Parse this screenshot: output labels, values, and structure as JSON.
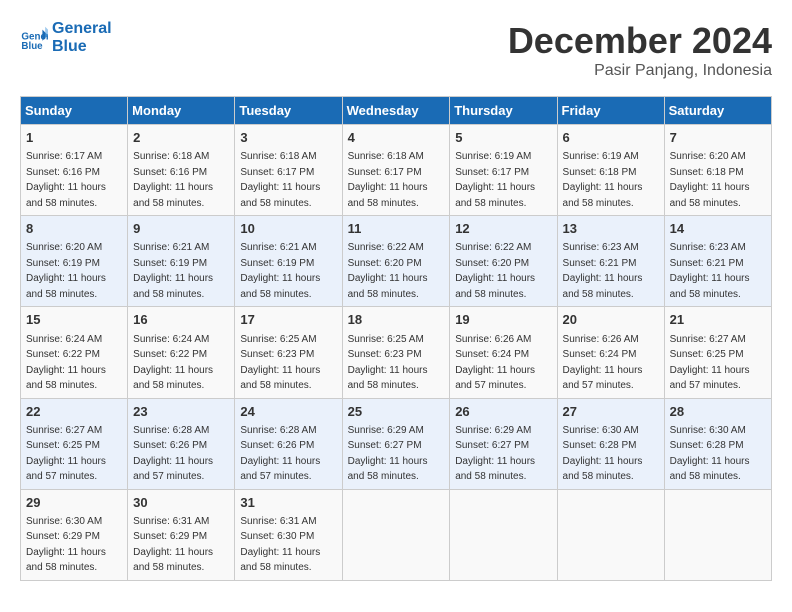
{
  "header": {
    "logo_line1": "General",
    "logo_line2": "Blue",
    "month": "December 2024",
    "location": "Pasir Panjang, Indonesia"
  },
  "days_of_week": [
    "Sunday",
    "Monday",
    "Tuesday",
    "Wednesday",
    "Thursday",
    "Friday",
    "Saturday"
  ],
  "weeks": [
    [
      {
        "day": "1",
        "sunrise": "6:17 AM",
        "sunset": "6:16 PM",
        "daylight": "11 hours and 58 minutes."
      },
      {
        "day": "2",
        "sunrise": "6:18 AM",
        "sunset": "6:16 PM",
        "daylight": "11 hours and 58 minutes."
      },
      {
        "day": "3",
        "sunrise": "6:18 AM",
        "sunset": "6:17 PM",
        "daylight": "11 hours and 58 minutes."
      },
      {
        "day": "4",
        "sunrise": "6:18 AM",
        "sunset": "6:17 PM",
        "daylight": "11 hours and 58 minutes."
      },
      {
        "day": "5",
        "sunrise": "6:19 AM",
        "sunset": "6:17 PM",
        "daylight": "11 hours and 58 minutes."
      },
      {
        "day": "6",
        "sunrise": "6:19 AM",
        "sunset": "6:18 PM",
        "daylight": "11 hours and 58 minutes."
      },
      {
        "day": "7",
        "sunrise": "6:20 AM",
        "sunset": "6:18 PM",
        "daylight": "11 hours and 58 minutes."
      }
    ],
    [
      {
        "day": "8",
        "sunrise": "6:20 AM",
        "sunset": "6:19 PM",
        "daylight": "11 hours and 58 minutes."
      },
      {
        "day": "9",
        "sunrise": "6:21 AM",
        "sunset": "6:19 PM",
        "daylight": "11 hours and 58 minutes."
      },
      {
        "day": "10",
        "sunrise": "6:21 AM",
        "sunset": "6:19 PM",
        "daylight": "11 hours and 58 minutes."
      },
      {
        "day": "11",
        "sunrise": "6:22 AM",
        "sunset": "6:20 PM",
        "daylight": "11 hours and 58 minutes."
      },
      {
        "day": "12",
        "sunrise": "6:22 AM",
        "sunset": "6:20 PM",
        "daylight": "11 hours and 58 minutes."
      },
      {
        "day": "13",
        "sunrise": "6:23 AM",
        "sunset": "6:21 PM",
        "daylight": "11 hours and 58 minutes."
      },
      {
        "day": "14",
        "sunrise": "6:23 AM",
        "sunset": "6:21 PM",
        "daylight": "11 hours and 58 minutes."
      }
    ],
    [
      {
        "day": "15",
        "sunrise": "6:24 AM",
        "sunset": "6:22 PM",
        "daylight": "11 hours and 58 minutes."
      },
      {
        "day": "16",
        "sunrise": "6:24 AM",
        "sunset": "6:22 PM",
        "daylight": "11 hours and 58 minutes."
      },
      {
        "day": "17",
        "sunrise": "6:25 AM",
        "sunset": "6:23 PM",
        "daylight": "11 hours and 58 minutes."
      },
      {
        "day": "18",
        "sunrise": "6:25 AM",
        "sunset": "6:23 PM",
        "daylight": "11 hours and 58 minutes."
      },
      {
        "day": "19",
        "sunrise": "6:26 AM",
        "sunset": "6:24 PM",
        "daylight": "11 hours and 57 minutes."
      },
      {
        "day": "20",
        "sunrise": "6:26 AM",
        "sunset": "6:24 PM",
        "daylight": "11 hours and 57 minutes."
      },
      {
        "day": "21",
        "sunrise": "6:27 AM",
        "sunset": "6:25 PM",
        "daylight": "11 hours and 57 minutes."
      }
    ],
    [
      {
        "day": "22",
        "sunrise": "6:27 AM",
        "sunset": "6:25 PM",
        "daylight": "11 hours and 57 minutes."
      },
      {
        "day": "23",
        "sunrise": "6:28 AM",
        "sunset": "6:26 PM",
        "daylight": "11 hours and 57 minutes."
      },
      {
        "day": "24",
        "sunrise": "6:28 AM",
        "sunset": "6:26 PM",
        "daylight": "11 hours and 57 minutes."
      },
      {
        "day": "25",
        "sunrise": "6:29 AM",
        "sunset": "6:27 PM",
        "daylight": "11 hours and 58 minutes."
      },
      {
        "day": "26",
        "sunrise": "6:29 AM",
        "sunset": "6:27 PM",
        "daylight": "11 hours and 58 minutes."
      },
      {
        "day": "27",
        "sunrise": "6:30 AM",
        "sunset": "6:28 PM",
        "daylight": "11 hours and 58 minutes."
      },
      {
        "day": "28",
        "sunrise": "6:30 AM",
        "sunset": "6:28 PM",
        "daylight": "11 hours and 58 minutes."
      }
    ],
    [
      {
        "day": "29",
        "sunrise": "6:30 AM",
        "sunset": "6:29 PM",
        "daylight": "11 hours and 58 minutes."
      },
      {
        "day": "30",
        "sunrise": "6:31 AM",
        "sunset": "6:29 PM",
        "daylight": "11 hours and 58 minutes."
      },
      {
        "day": "31",
        "sunrise": "6:31 AM",
        "sunset": "6:30 PM",
        "daylight": "11 hours and 58 minutes."
      },
      null,
      null,
      null,
      null
    ]
  ]
}
